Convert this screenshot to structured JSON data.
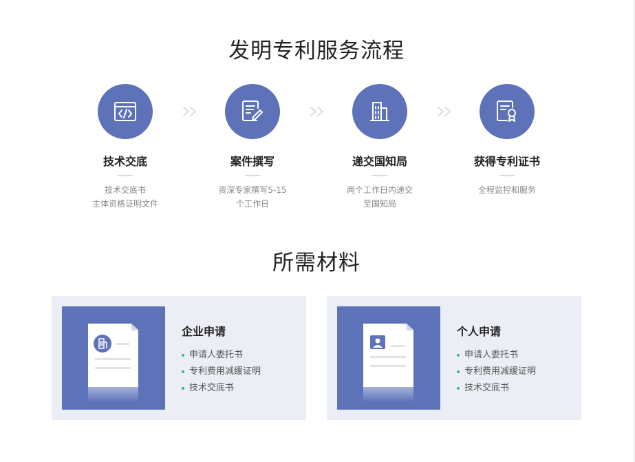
{
  "process": {
    "title": "发明专利服务流程",
    "steps": [
      {
        "icon": "code-window-icon",
        "name": "技术交底",
        "desc1": "技术交底书",
        "desc2": "主体资格证明文件"
      },
      {
        "icon": "edit-document-icon",
        "name": "案件撰写",
        "desc1": "资深专家撰写5-15",
        "desc2": "个工作日"
      },
      {
        "icon": "building-icon",
        "name": "递交国知局",
        "desc1": "两个工作日内递交",
        "desc2": "至国知局"
      },
      {
        "icon": "certificate-icon",
        "name": "获得专利证书",
        "desc1": "全程监控和服务",
        "desc2": ""
      }
    ]
  },
  "materials": {
    "title": "所需材料",
    "cards": [
      {
        "icon": "building-icon",
        "heading": "企业申请",
        "items": [
          "申请人委托书",
          "专利费用减缓证明",
          "技术交底书"
        ]
      },
      {
        "icon": "person-card-icon",
        "heading": "个人申请",
        "items": [
          "申请人委托书",
          "专利费用减缓证明",
          "技术交底书"
        ]
      }
    ]
  },
  "colors": {
    "accent": "#5d72b8",
    "card_bg": "#eceef6",
    "bullet": "#38b485"
  }
}
